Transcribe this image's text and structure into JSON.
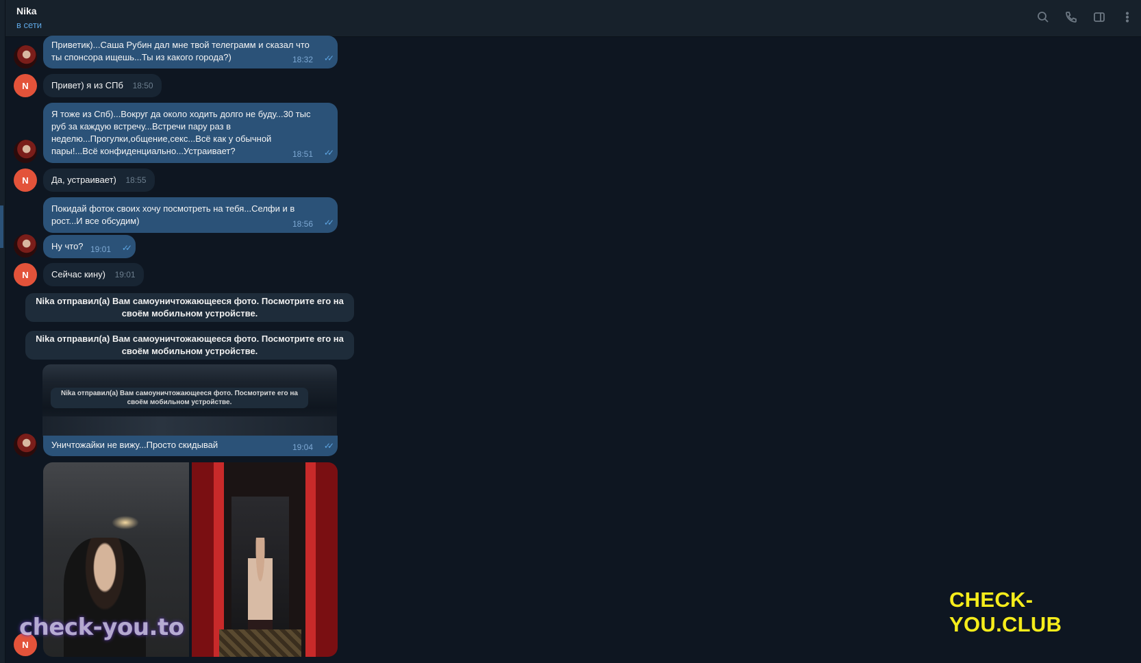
{
  "header": {
    "contact_name": "Nika",
    "status": "в сети",
    "icons": [
      "search-icon",
      "phone-icon",
      "sidebar-toggle-icon",
      "more-vertical-icon"
    ]
  },
  "messages": [
    {
      "sender": "me",
      "text": "Приветик)...Саша Рубин дал мне твой телеграмм и сказал что ты спонсора ищешь...Ты из какого города?)",
      "time": "18:32"
    },
    {
      "sender": "nika",
      "text": "Привет) я из СПб",
      "time": "18:50"
    },
    {
      "sender": "me",
      "text": "Я тоже из Спб)...Вокруг да около ходить долго не буду...30 тыс руб за каждую встречу...Встречи пару раз в неделю...Прогулки,общение,секс...Всё как у обычной пары!...Всё конфиденциально...Устраивает?",
      "time": "18:51"
    },
    {
      "sender": "nika",
      "text": "Да, устраивает)",
      "time": "18:55"
    },
    {
      "sender": "me",
      "text": "Покидай фоток своих хочу посмотреть на тебя...Селфи и в рост...И все обсудим)",
      "time": "18:56"
    },
    {
      "sender": "me",
      "text": "Ну что?",
      "time": "19:01"
    },
    {
      "sender": "nika",
      "text": "Сейчас кину)",
      "time": "19:01"
    },
    {
      "sender": "me",
      "text": "Уничтожайки не вижу...Просто скидывай",
      "time": "19:04"
    }
  ],
  "service_messages": [
    "Nika отправил(а) Вам самоуничтожающееся фото. Посмотрите его на своём мобильном устройстве.",
    "Nika отправил(а) Вам самоуничтожающееся фото. Посмотрите его на своём мобильном устройстве."
  ],
  "screenshot_caption": "Nika отправил(а) Вам самоуничтожающееся фото. Посмотрите его на своём мобильном устройстве.",
  "avatar_initial": "N",
  "ticks": "✓✓",
  "watermarks": {
    "left": "check-you.to",
    "right": "CHECK-YOU.CLUB"
  },
  "colors": {
    "background": "#0e1621",
    "header": "#17212b",
    "outgoing_bubble": "#2b5278",
    "incoming_bubble": "#182533",
    "accent": "#5ea6e3",
    "avatar_n": "#e3533a",
    "watermark_right": "#f5ec1b"
  }
}
